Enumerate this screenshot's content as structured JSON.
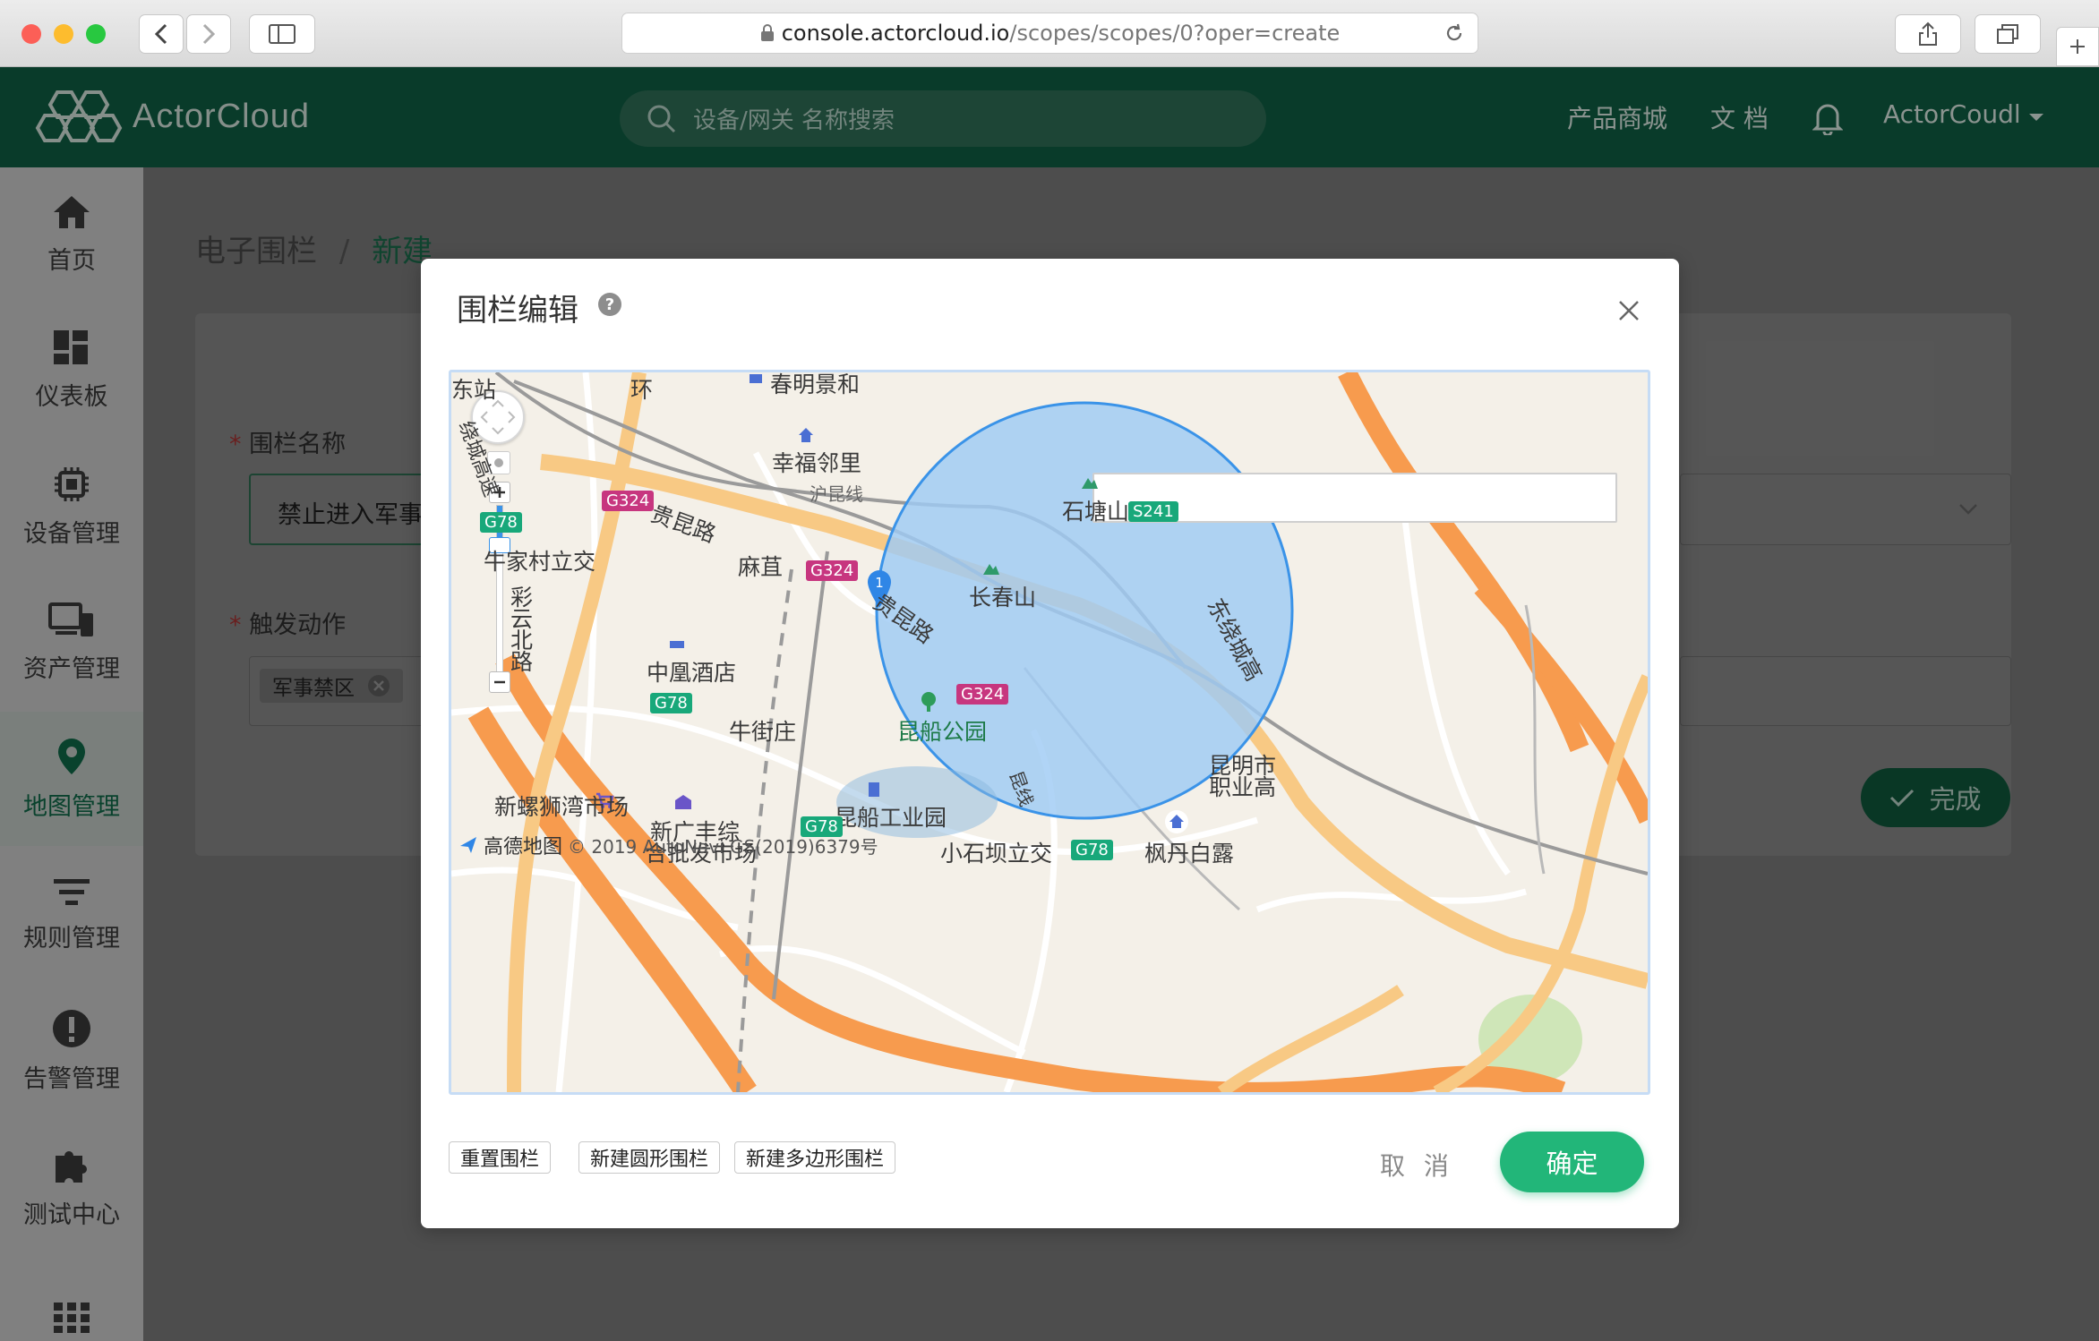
{
  "browser": {
    "url_host": "console.actorcloud.io",
    "url_path": "/scopes/scopes/0?oper=create"
  },
  "header": {
    "logo_text": "ActorCloud",
    "search_placeholder": "设备/网关 名称搜索",
    "links": [
      "产品商城",
      "文 档"
    ],
    "user": "ActorCoudl"
  },
  "sidebar": {
    "items": [
      {
        "label": "首页",
        "icon": "home-icon"
      },
      {
        "label": "仪表板",
        "icon": "dashboard-icon"
      },
      {
        "label": "设备管理",
        "icon": "chip-icon"
      },
      {
        "label": "资产管理",
        "icon": "devices-icon"
      },
      {
        "label": "地图管理",
        "icon": "map-pin-icon",
        "active": true
      },
      {
        "label": "规则管理",
        "icon": "filter-icon"
      },
      {
        "label": "告警管理",
        "icon": "alert-icon"
      },
      {
        "label": "测试中心",
        "icon": "puzzle-icon"
      }
    ]
  },
  "page": {
    "breadcrumb_parent": "电子围栏",
    "breadcrumb_sep": "/",
    "breadcrumb_current": "新建",
    "field_name_label": "围栏名称",
    "field_name_value": "禁止进入军事",
    "field_action_label": "触发动作",
    "action_tag": "军事禁区",
    "done_button": "完成",
    "required_mark": "*"
  },
  "modal": {
    "title": "围栏编辑",
    "help": "?",
    "reset_button": "重置围栏",
    "circle_button": "新建圆形围栏",
    "polygon_button": "新建多边形围栏",
    "cancel_button": "取 消",
    "confirm_button": "确定",
    "map": {
      "labels": {
        "l1": "东站",
        "l2": "环",
        "l3": "春明景和",
        "l4": "幸福邻里",
        "l5": "沪昆线",
        "l6": "贵昆路",
        "l7": "麻苴",
        "l8": "贵昆路",
        "l9": "长春山",
        "l10": "石塘山",
        "l11": "牛家村立交",
        "l12": "彩",
        "l13": "云",
        "l14": "北",
        "l15": "路",
        "l16": "中凰酒店",
        "l17": "牛街庄",
        "l18": "昆船公园",
        "l19": "新螺狮湾市场",
        "l20": "新广丰综",
        "l21": "合批发市场",
        "l22": "昆船工业园",
        "l23": "小石坝立交",
        "l24": "枫丹白露",
        "l25": "昆明市",
        "l26": "职业高",
        "l27": "东绕城高",
        "l28": "昆线",
        "l29": "绕城高速"
      },
      "shields": {
        "s1": "G324",
        "s2": "G324",
        "s3": "G324",
        "s4": "S241",
        "s5": "G78",
        "s6": "G78",
        "s7": "G78",
        "s8": "G78"
      },
      "marker": "1",
      "copyright": "© 2019 AutoNavi GS(2019)6379号",
      "brand": "高德地图"
    }
  }
}
